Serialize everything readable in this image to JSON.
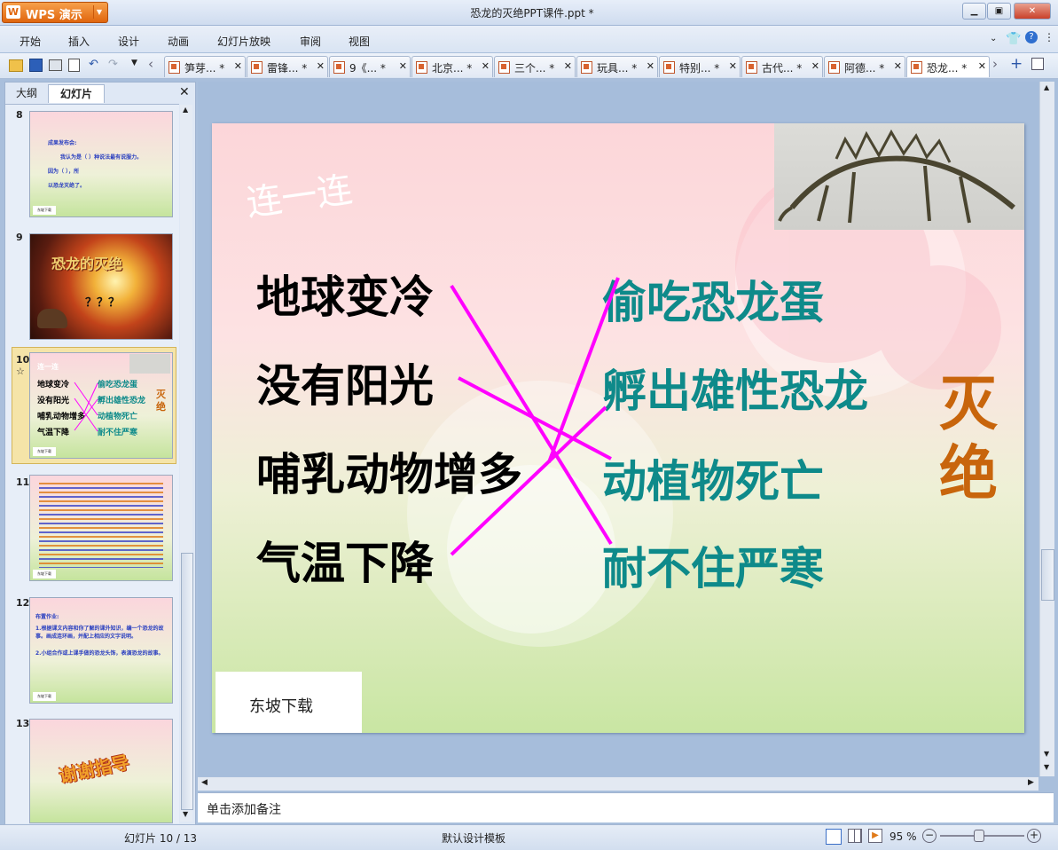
{
  "app": {
    "brand": "WPS 演示",
    "document_title": "恐龙的灭绝PPT课件.ppt *"
  },
  "menu": [
    "开始",
    "插入",
    "设计",
    "动画",
    "幻灯片放映",
    "审阅",
    "视图"
  ],
  "doc_tabs": [
    "笋芽... *",
    "雷锋... *",
    "9《... *",
    "北京... *",
    "三个... *",
    "玩具... *",
    "特别... *",
    "古代... *",
    "阿德... *",
    "恐龙... *"
  ],
  "panel": {
    "tab_outline": "大纲",
    "tab_slides": "幻灯片"
  },
  "thumbnails": [
    {
      "number": "8",
      "lines": [
        "成果发布会:",
        "我认为是（ ）种说法最有说服力。",
        "因为（ ），所",
        "以恐龙灭绝了。"
      ],
      "footer": "东坡下载"
    },
    {
      "number": "9",
      "title": "恐龙的灭绝",
      "marks": "？？？"
    },
    {
      "number": "10",
      "star": "☆",
      "title": "连一连",
      "left": [
        "地球变冷",
        "没有阳光",
        "哺乳动物增多",
        "气温下降"
      ],
      "right": [
        "偷吃恐龙蛋",
        "孵出雄性恐龙",
        "动植物死亡",
        "耐不住严寒"
      ],
      "side": "灭绝",
      "footer": "东坡下载"
    },
    {
      "number": "11",
      "footer": "东坡下载"
    },
    {
      "number": "12",
      "lines": [
        "布置作业:",
        "1.根据课文内容和你了解的课外知识，编一个恐龙的故事。画成连环画，并配上相应的文字说明。",
        "2.小组合作或上课手做的恐龙头饰，表演恐龙的故事。"
      ],
      "footer": "东坡下载"
    },
    {
      "number": "13",
      "title": "谢谢指导"
    }
  ],
  "slide": {
    "heading": "连一连",
    "left_items": [
      "地球变冷",
      "没有阳光",
      "哺乳动物增多",
      "气温下降"
    ],
    "right_items": [
      "偷吃恐龙蛋",
      "孵出雄性恐龙",
      "动植物死亡",
      "耐不住严寒"
    ],
    "side_word": "灭绝",
    "footer_box": "东坡下载",
    "connections": [
      [
        0,
        2
      ],
      [
        1,
        3
      ],
      [
        2,
        0
      ],
      [
        3,
        1
      ]
    ],
    "colors": {
      "left_text": "#000000",
      "right_text": "#0e8a8a",
      "side_text": "#c8650c",
      "lines": "#ff00ff",
      "heading": "#ffffff"
    }
  },
  "notes_placeholder": "单击添加备注",
  "status": {
    "slide_counter": "幻灯片 10 / 13",
    "template": "默认设计模板",
    "zoom": "95 %"
  },
  "colors": {
    "wps_orange": "#e0660e",
    "chrome": "#d9e4f3",
    "selection": "#f5e4a8"
  }
}
